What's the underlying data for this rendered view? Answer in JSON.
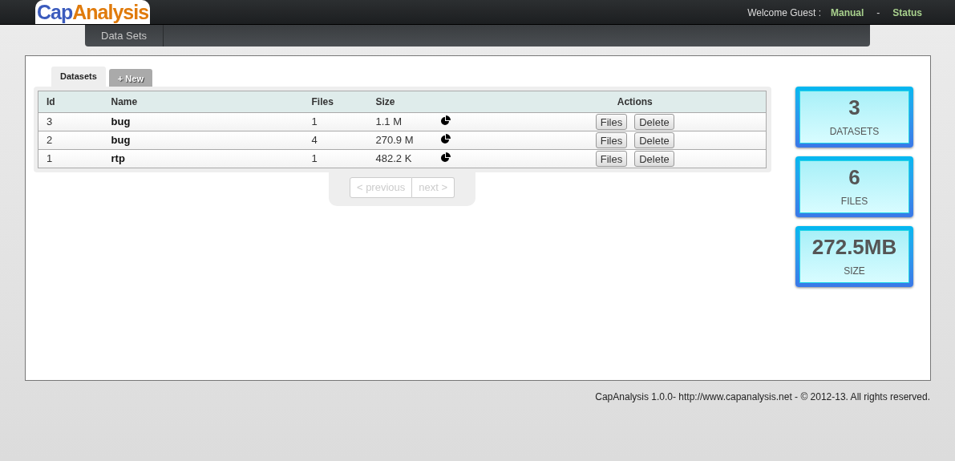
{
  "header": {
    "logo": {
      "part_1": "Cap",
      "part_2": "Analysis"
    },
    "welcome": "Welcome Guest :",
    "links": [
      "Manual",
      "Status"
    ],
    "separator": "-"
  },
  "nav": {
    "items": [
      {
        "label": "Data Sets",
        "selected": false
      }
    ]
  },
  "tabs": [
    {
      "label": "Datasets",
      "kind": "tab",
      "selected": true
    },
    {
      "label": "+ New",
      "kind": "add",
      "selected": false
    }
  ],
  "table": {
    "columns": [
      "Id",
      "Name",
      "Files",
      "Size",
      "Actions"
    ],
    "rows": [
      {
        "id": "3",
        "name": "bug",
        "files": "1",
        "size": "1.1 M",
        "actions": [
          "Files",
          "Delete"
        ]
      },
      {
        "id": "2",
        "name": "bug",
        "files": "4",
        "size": "270.9 M",
        "actions": [
          "Files",
          "Delete"
        ]
      },
      {
        "id": "1",
        "name": "rtp",
        "files": "1",
        "size": "482.2 K",
        "actions": [
          "Files",
          "Delete"
        ]
      }
    ]
  },
  "pagination": [
    {
      "label": "< previous",
      "disabled": true
    },
    {
      "label": "next >",
      "disabled": true
    }
  ],
  "stats": [
    {
      "value": "3",
      "label": "DATASETS"
    },
    {
      "value": "6",
      "label": "FILES"
    },
    {
      "value": "272.5MB",
      "label": "SIZE"
    }
  ],
  "footer": "CapAnalysis 1.0.0- http://www.capanalysis.net - © 2012-13. All rights reserved."
}
